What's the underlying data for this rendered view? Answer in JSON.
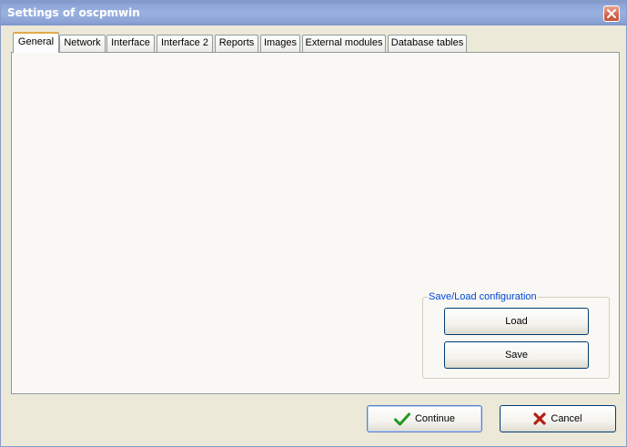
{
  "window": {
    "title": "Settings of oscpmwin"
  },
  "tabs": [
    {
      "label": "General",
      "active": true
    },
    {
      "label": "Network",
      "active": false
    },
    {
      "label": "Interface",
      "active": false
    },
    {
      "label": "Interface 2",
      "active": false
    },
    {
      "label": "Reports",
      "active": false
    },
    {
      "label": "Images",
      "active": false
    },
    {
      "label": "External modules",
      "active": false
    },
    {
      "label": "Database tables",
      "active": false
    }
  ],
  "save_load": {
    "legend": "Save/Load configuration",
    "load_label": "Load",
    "save_label": "Save"
  },
  "dialog_buttons": {
    "continue_label": "Continue",
    "cancel_label": "Cancel"
  },
  "icons": {
    "close": "close-icon",
    "continue": "checkmark-icon",
    "cancel": "x-cross-icon"
  },
  "colors": {
    "titlebar": "#8ea7d8",
    "active_tab_highlight": "#e2a94a",
    "legend_text": "#0046d5",
    "checkmark": "#1f9a1f",
    "cancel_cross": "#b41e14"
  }
}
